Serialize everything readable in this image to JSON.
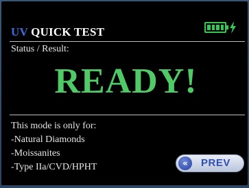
{
  "header": {
    "title_prefix": "UV",
    "title_rest": " QUICK TEST",
    "battery_icon": "battery-full-charging-icon"
  },
  "status": {
    "label": "Status / Result:",
    "value": "READY!"
  },
  "mode_info": {
    "lines": [
      "This mode is only for:",
      "-Natural Diamonds",
      "-Moissanites",
      "-Type IIa/CVD/HPHT"
    ]
  },
  "prev_button": {
    "label": "PREV",
    "icon": "double-chevron-left-icon"
  },
  "colors": {
    "accent_uv": "#3b6fe0",
    "ready_green": "#4fca66",
    "battery_green": "#34c957"
  }
}
